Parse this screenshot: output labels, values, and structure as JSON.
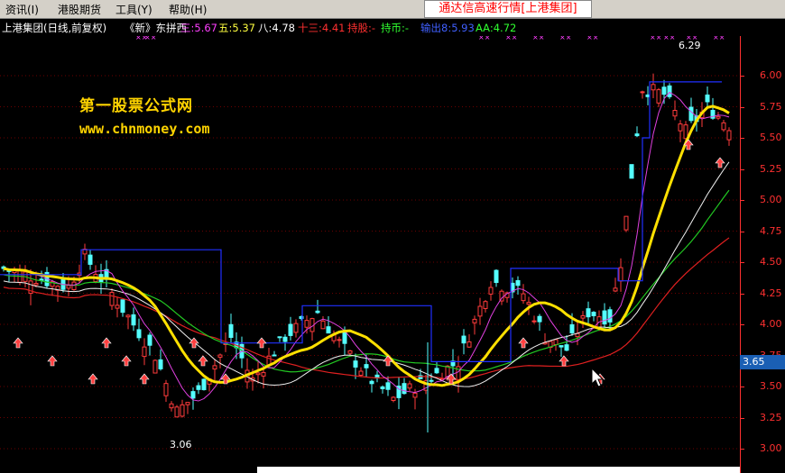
{
  "menu": {
    "items": [
      "资讯(I)",
      "港股期货",
      "工具(Y)",
      "帮助(H)"
    ]
  },
  "title": "通达信高速行情[上港集团]",
  "indicator_row": {
    "stock": "上港集团(日线,前复权)",
    "tag": "《新》东拼西",
    "san": "三:5.67",
    "wu": "五:5.37",
    "ba": "八:4.78",
    "shisan": "十三:4.41",
    "chigu": "持股:-",
    "chibi": "持币:-",
    "shuchu": "输出8:5.93",
    "aa": "AA:4.72"
  },
  "watermark": {
    "line1": "第一股票公式网",
    "line2": "www.chnmoney.com"
  },
  "price_axis": {
    "ticks": [
      "6.00",
      "5.75",
      "5.50",
      "5.25",
      "5.00",
      "4.75",
      "4.50",
      "4.25",
      "4.00",
      "3.75",
      "3.50",
      "3.25",
      "3.00"
    ]
  },
  "current_price": "3.65",
  "high_label": "6.29",
  "low_label": "3.06",
  "colors": {
    "bull": "#ff3b3b",
    "bear": "#54ffff",
    "ma_red": "#e02020",
    "ma_green": "#22c822",
    "ma_white": "#f0f0f0",
    "ma_magenta": "#e040e0",
    "signal_blue": "#2030ff",
    "thick_line": "#ffe000"
  }
}
